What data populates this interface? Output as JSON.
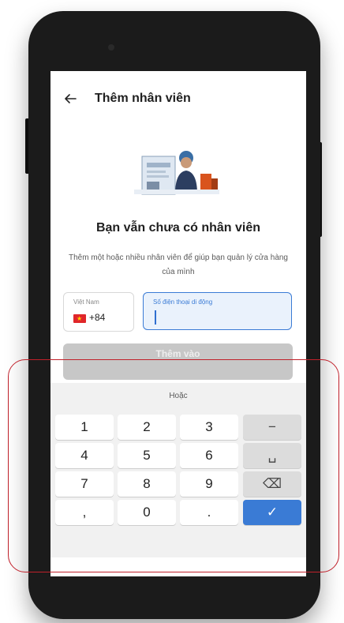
{
  "appbar": {
    "title": "Thêm nhân viên",
    "back_icon": "arrow-left-icon"
  },
  "empty_state": {
    "illustration_icon": "employee-illustration",
    "heading": "Bạn vẫn chưa có nhân viên",
    "description": "Thêm một hoặc nhiều nhân viên để giúp bạn quản lý cửa hàng của mình"
  },
  "country": {
    "label": "Việt Nam",
    "code": "+84",
    "flag_icon": "vietnam-flag-icon"
  },
  "phone_input": {
    "placeholder": "Số điện thoại di động",
    "value": ""
  },
  "add_button": {
    "label": "Thêm vào"
  },
  "keyboard": {
    "hint": "Hoặc",
    "rows": [
      [
        "1",
        "2",
        "3",
        "−"
      ],
      [
        "4",
        "5",
        "6",
        "␣"
      ],
      [
        "7",
        "8",
        "9",
        "⌫"
      ],
      [
        ",",
        "0",
        ".",
        "✓"
      ]
    ]
  },
  "colors": {
    "accent": "#3a7bd5",
    "highlight": "#c0202a",
    "button_disabled": "#c7c7c7"
  }
}
